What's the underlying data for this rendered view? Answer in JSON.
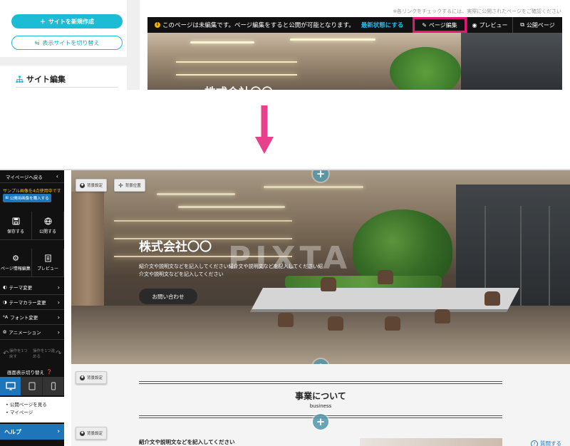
{
  "top": {
    "new_site_label": "サイトを新規作成",
    "switch_site_label": "表示サイトを切り替え",
    "site_edit_title": "サイト編集",
    "notice": "※各リンクをチェックするには、実際に公開されたページをご確認ください",
    "toolbar": {
      "status_text": "このページは未編集です。ページ編集をすると公開が可能となります。",
      "latest_label": "最新状態にする",
      "edit_label": "ページ編集",
      "preview_label": "プレビュー",
      "public_label": "公開ページ"
    },
    "hero_title": "株式会社〇〇"
  },
  "colors": {
    "accent": "#1cbcd4",
    "highlight": "#e4157d",
    "arrow": "#e8418b",
    "help_blue": "#1e76b9"
  },
  "editor": {
    "sidebar": {
      "back_label": "マイページへ戻る",
      "sample_info": "サンプル画像を4点使用中です",
      "purchase_label": "公開用画像を購入する",
      "save_label": "保存する",
      "publish_label": "公開する",
      "page_info_label": "ページ情報編集",
      "preview_label": "プレビュー",
      "menu": [
        {
          "label": "テーマ変更",
          "icon": "theme-icon"
        },
        {
          "label": "テーマカラー変更",
          "icon": "palette-icon"
        },
        {
          "label": "フォント変更",
          "icon": "font-icon"
        },
        {
          "label": "アニメーション",
          "icon": "animation-icon"
        }
      ],
      "undo_label": "操作を1つ戻す",
      "redo_label": "操作を1つ進める",
      "display_toggle_label": "画面表示切り替え",
      "links": [
        "公開ページを見る",
        "マイページ"
      ],
      "help_label": "ヘルプ"
    },
    "hero": {
      "bg_setting_label": "背景設定",
      "bg_position_label": "背景位置",
      "title": "株式会社〇〇",
      "desc": "紹介文や説明文などを記入してください紹介文や説明文などを記入してください紹介文や説明文などを記入してください",
      "contact_label": "お問い合わせ",
      "watermark": "PIXTA"
    },
    "business": {
      "bg_setting_label": "背景設定",
      "title": "事業について",
      "subtitle": "business",
      "desc": "紹介文や説明文などを記入してください",
      "question_label": "質問する"
    }
  }
}
